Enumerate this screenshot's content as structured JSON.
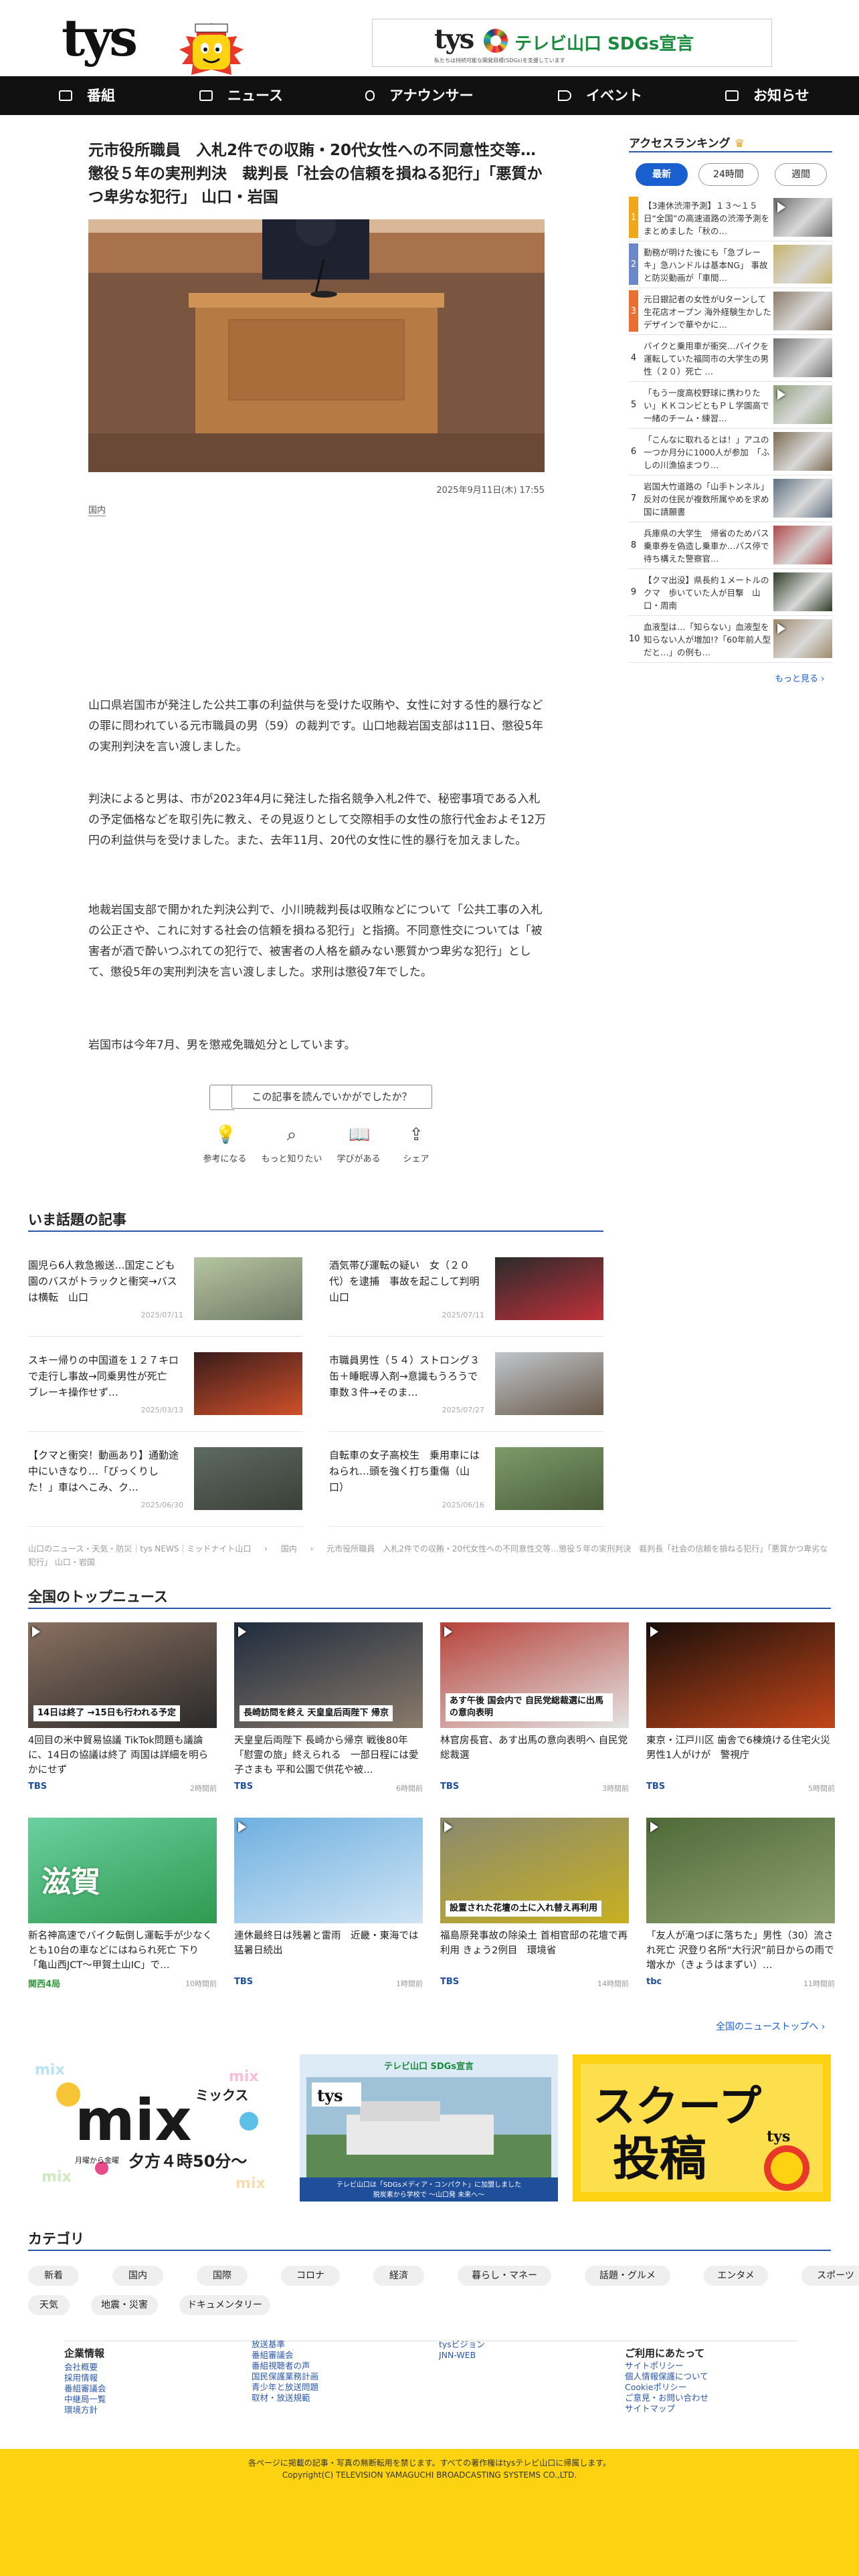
{
  "header": {
    "logo_text": "tys",
    "sdgs_logo_text": "tys",
    "sdgs_title": "テレビ山口 SDGs宣言",
    "sdgs_sub": "私たちは持続可能な開発目標(SDGs)を支援しています"
  },
  "nav": [
    {
      "label": "番組"
    },
    {
      "label": "ニュース"
    },
    {
      "label": "アナウンサー"
    },
    {
      "label": "イベント"
    },
    {
      "label": "お知らせ"
    }
  ],
  "article": {
    "title": "元市役所職員　入札2件での収賄・20代女性への不同意性交等…懲役５年の実刑判決　裁判長「社会の信頼を損ねる犯行」「悪質かつ卑劣な犯行」 山口・岩国",
    "date": "2025年9月11日(木) 17:55",
    "category": "国内",
    "paragraphs": [
      "山口県岩国市が発注した公共工事の利益供与を受けた収賄や、女性に対する性的暴行などの罪に問われている元市職員の男（59）の裁判です。山口地裁岩国支部は11日、懲役5年の実刑判決を言い渡しました。",
      "判決によると男は、市が2023年4月に発注した指名競争入札2件で、秘密事項である入札の予定価格などを取引先に教え、その見返りとして交際相手の女性の旅行代金およそ12万円の利益供与を受けました。また、去年11月、20代の女性に性的暴行を加えました。",
      "地裁岩国支部で開かれた判決公判で、小川暁裁判長は収賄などについて「公共工事の入札の公正さや、これに対する社会の信頼を損ねる犯行」と指摘。不同意性交については「被害者が酒で酔いつぶれての犯行で、被害者の人格を顧みない悪質かつ卑劣な犯行」として、懲役5年の実刑判決を言い渡しました。求刑は懲役7年でした。",
      "岩国市は今年7月、男を懲戒免職処分としています。"
    ],
    "feedback_question": "この記事を読んでいかがでしたか？",
    "feedback": [
      {
        "label": "参考になる"
      },
      {
        "label": "もっと知りたい"
      },
      {
        "label": "学びがある"
      },
      {
        "label": "シェア"
      }
    ]
  },
  "ranking": {
    "title": "アクセスランキング",
    "tabs": [
      {
        "label": "最新"
      },
      {
        "label": "24時間"
      },
      {
        "label": "週間"
      }
    ],
    "items": [
      {
        "rank": "1",
        "text": "【3連休渋滞予測】１３～１５日“全国”の高速道路の渋滞予測をまとめました「秋の…",
        "color": "#f0a818"
      },
      {
        "rank": "2",
        "text": "勤務が明けた後にも「急ブレーキ」急ハンドルは基本NG」 事故と防災動画が「車間…",
        "color": "#6d88c8"
      },
      {
        "rank": "3",
        "text": "元日銀記者の女性がUターンして生花店オープン 海外経験生かしたデザインで華やかに…",
        "color": "#e87030"
      },
      {
        "rank": "4",
        "text": "バイクと乗用車が衝突…バイクを運転していた福岡市の大学生の男性（２０）死亡 …",
        "color": ""
      },
      {
        "rank": "5",
        "text": "「もう一度高校野球に携わりたい」ＫＫコンビともＰＬ学園高で一緒のチーム・練習…",
        "color": ""
      },
      {
        "rank": "6",
        "text": "「こんなに取れるとは！」アユの一つか月分に1000人が参加　「ふしの川漁協まつり…",
        "color": ""
      },
      {
        "rank": "7",
        "text": "岩国大竹道路の「山手トンネル」反対の住民が複数所属やめを求め国に請願書",
        "color": ""
      },
      {
        "rank": "8",
        "text": "兵庫県の大学生　帰省のためバス乗車券を偽造し乗車か…バス停で待ち構えた警察官…",
        "color": ""
      },
      {
        "rank": "9",
        "text": "【クマ出没】県長約１メートルのクマ　歩いていた人が目撃　山口・周南",
        "color": ""
      },
      {
        "rank": "10",
        "text": "血液型は…「知らない」血液型を知らない人が増加!?「60年前人型だと…」の例も…",
        "color": ""
      }
    ],
    "more": "もっと見る ›"
  },
  "hot": {
    "title": "いま話題の記事",
    "items": [
      {
        "title": "園児ら6人救急搬送…国定こども園のバスがトラックと衝突→バスは横転　山口",
        "date": "2025/07/11"
      },
      {
        "title": "酒気帯び運転の疑い　女（２０代）を逮捕　事故を起こして判明　山口",
        "date": "2025/07/11"
      },
      {
        "title": "スキー帰りの中国道を１２７キロで走行し事故→同乗男性が死亡　ブレーキ操作せず…",
        "date": "2025/03/13"
      },
      {
        "title": "市職員男性（５４）ストロング３缶＋睡眠導入剤→意識もうろうで車数３件→そのま…",
        "date": "2025/07/27"
      },
      {
        "title": "【クマと衝突！動画あり】通勤途中にいきなり…「びっくりした！」車はへこみ、ク…",
        "date": "2025/06/30"
      },
      {
        "title": "自転車の女子高校生　乗用車にはねられ…頭を強く打ち重傷（山口）",
        "date": "2025/06/16"
      }
    ]
  },
  "breadcrumb": [
    "山口のニュース・天気・防災｜tys NEWS｜ミッドナイト山口",
    "国内",
    "元市役所職員　入札2件での収賄・20代女性への不同意性交等…懲役５年の実刑判決　裁判長「社会の信頼を損ねる犯行」「悪質かつ卑劣な犯行」 山口・岩国"
  ],
  "topnews": {
    "title": "全国のトップニュース",
    "items": [
      {
        "title": "4回目の米中貿易協議 TikTok問題も議論に、14日の協議は終了 両国は詳細を明らかにせず",
        "source": "TBS",
        "time": "2時間前",
        "caption": "14日は終了 →15日も行われる予定"
      },
      {
        "title": "天皇皇后両陛下 長崎から帰京 戦後80年「慰霊の旅」終えられる　一部日程には愛子さまも 平和公園で供花や被…",
        "source": "TBS",
        "time": "6時間前",
        "caption": "長崎訪問を終え 天皇皇后両陛下 帰京"
      },
      {
        "title": "林官房長官、あす出馬の意向表明へ 自民党総裁選",
        "source": "TBS",
        "time": "3時間前",
        "caption": "あす午後 国会内で 自民党総裁選に出馬の意向表明"
      },
      {
        "title": "東京・江戸川区 歯舎で6棟焼ける住宅火災　男性1人がけが　警視庁",
        "source": "TBS",
        "time": "5時間前",
        "caption": ""
      },
      {
        "title": "新名神高速でバイク転倒し運転手が少なくとも10台の車などにはねられ死亡 下り「亀山西JCT～甲賀土山IC」で…",
        "source": "関西4局",
        "time": "10時間前",
        "caption": "滋賀"
      },
      {
        "title": "連休最終日は残暑と雷雨　近畿・東海では猛暑日続出",
        "source": "TBS",
        "time": "1時間前",
        "caption": ""
      },
      {
        "title": "福島原発事故の除染土 首相官邸の花壇で再利用 きょう2例目　環境省",
        "source": "TBS",
        "time": "14時間前",
        "caption": "設置された花壇の土に入れ替え再利用"
      },
      {
        "title": "「友人が滝つぼに落ちた」男性（30）流され死亡 沢登り名所“大行沢”前日からの雨で増水か（きょうはまずい）…",
        "source": "tbc",
        "time": "11時間前",
        "caption": ""
      }
    ],
    "more": "全国のニューストップへ ›"
  },
  "banners": [
    {
      "name": "mix",
      "text1": "mix",
      "text2": "ミックス",
      "text3": "夕方４時50分～",
      "text4": "月曜から金曜"
    },
    {
      "name": "sdgs",
      "text1": "テレビ山口 SDGs宣言",
      "text2": "tys",
      "text3": "テレビ山口は「SDGsメディア・コンパクト」に加盟しました",
      "text4": "脱炭素から学校で ～山口発 未来へ～"
    },
    {
      "name": "scoop",
      "text1": "スクープ",
      "text2": "投稿",
      "text3": "tys"
    }
  ],
  "categories": {
    "title": "カテゴリ",
    "items": [
      "新着",
      "国内",
      "国際",
      "コロナ",
      "経済",
      "暮らし・マネー",
      "話題・グルメ",
      "エンタメ",
      "スポーツ",
      "天気",
      "地震・災害",
      "ドキュメンタリー"
    ]
  },
  "footer": {
    "col1_title": "企業情報",
    "col1": [
      "会社概要",
      "採用情報",
      "番組審議会",
      "中継局一覧",
      "環境方針"
    ],
    "col2": [
      "放送基準",
      "番組審議会",
      "番組視聴者の声",
      "国民保護業務計画",
      "青少年と放送問題",
      "取材・放送規範"
    ],
    "col3": [
      "tysビジョン",
      "JNN-WEB"
    ],
    "col4_title": "ご利用にあたって",
    "col4": [
      "サイトポリシー",
      "個人情報保護について",
      "Cookieポリシー",
      "ご意見・お問い合わせ",
      "サイトマップ"
    ],
    "notice": "各ページに掲載の記事・写真の無断転用を禁じます。すべての著作権はtysテレビ山口に帰属します。",
    "copyright": "Copyright(C) TELEVISION YAMAGUCHI BROADCASTING SYSTEMS CO.,LTD."
  }
}
